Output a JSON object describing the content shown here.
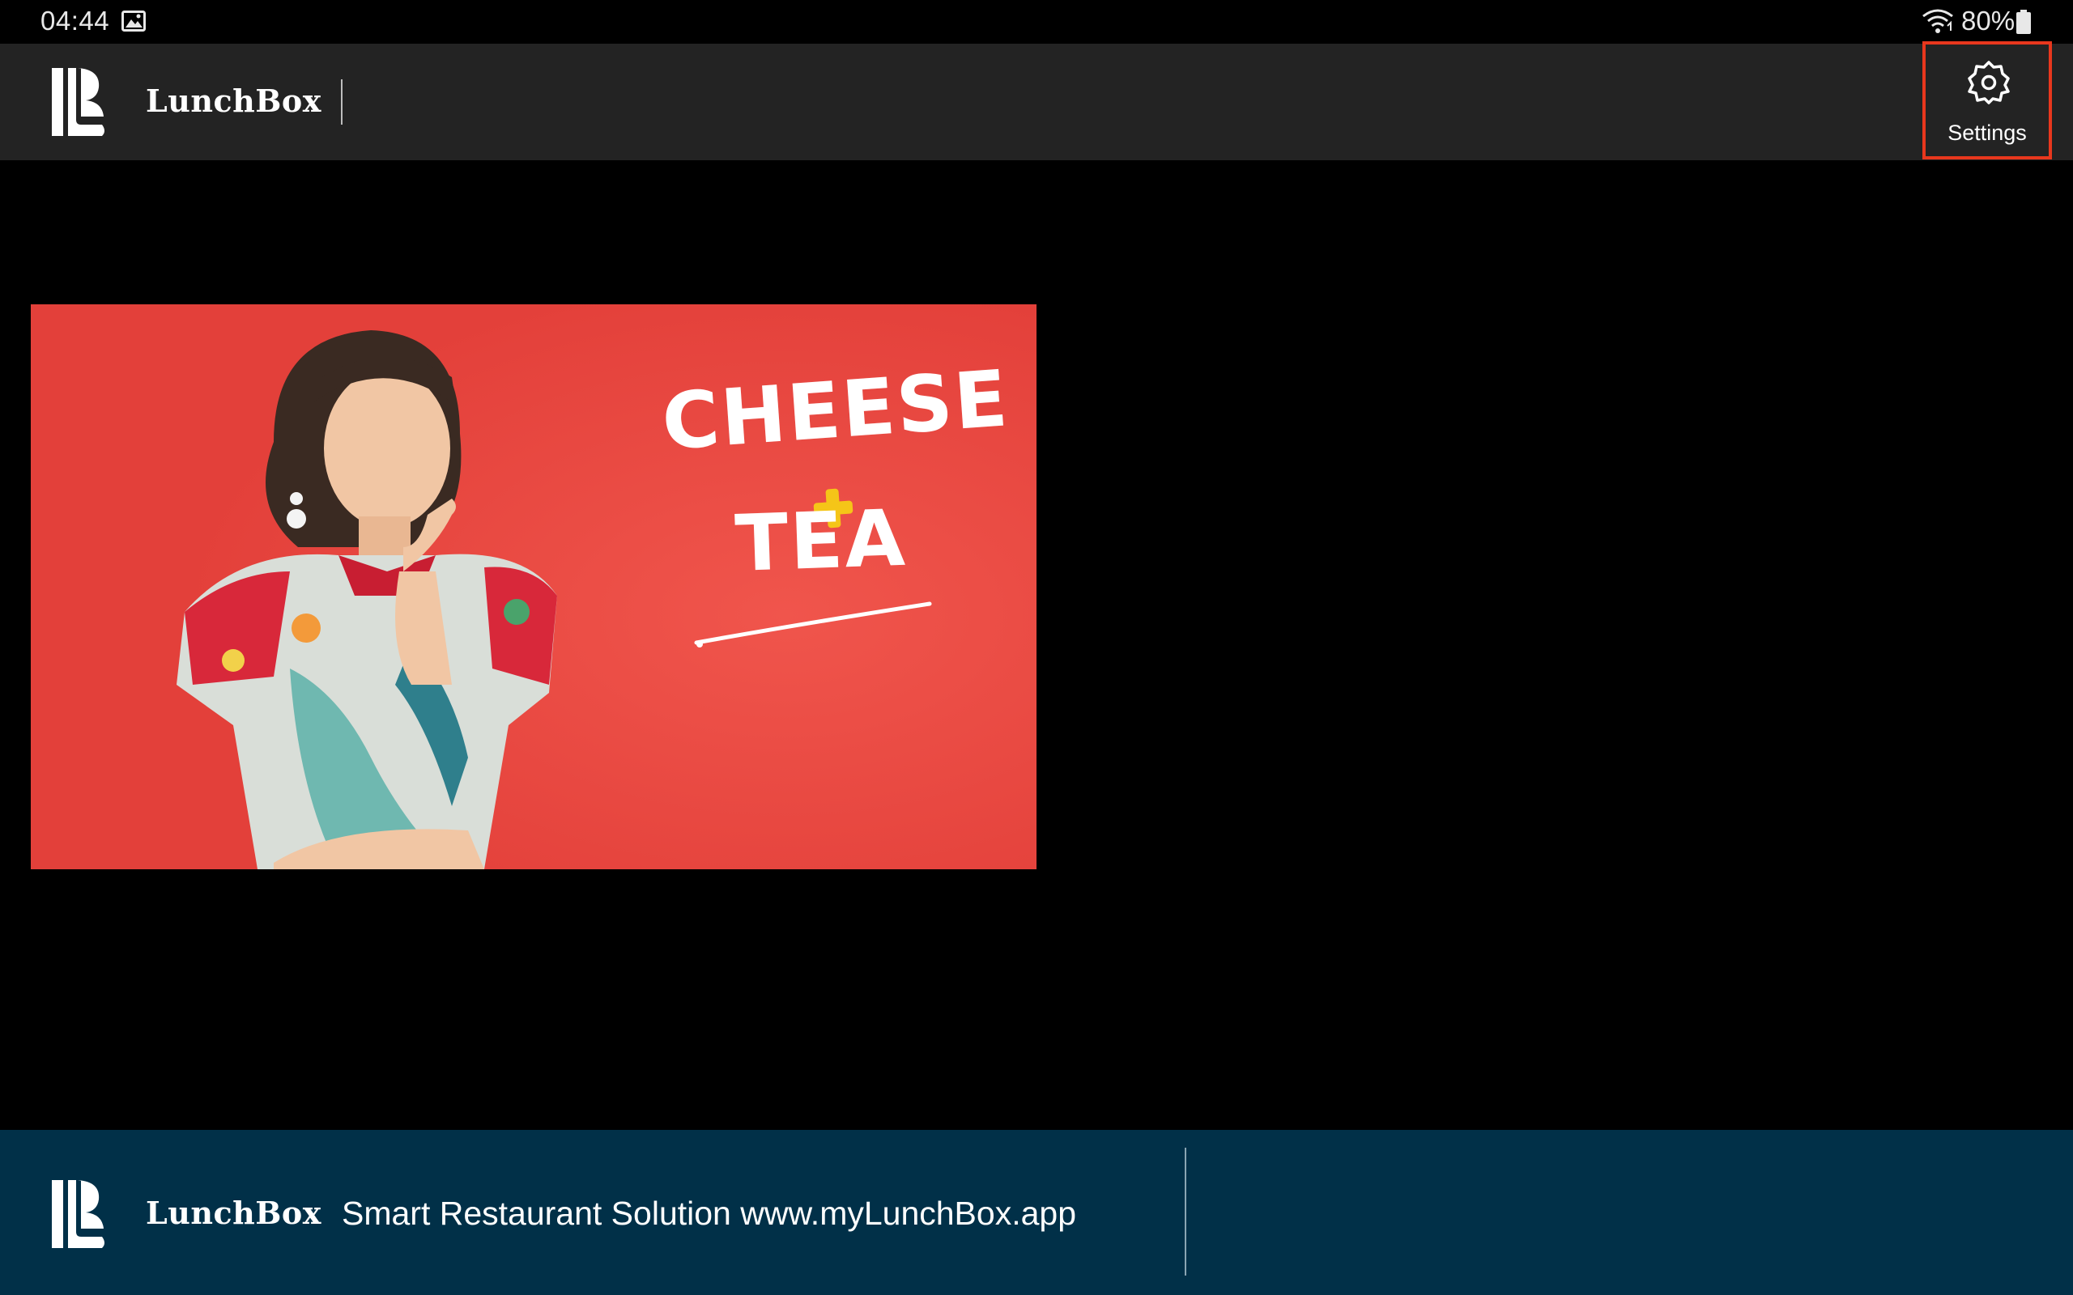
{
  "status_bar": {
    "time": "04:44",
    "battery": "80%",
    "icons": [
      "gallery-icon",
      "wifi-icon",
      "battery-icon"
    ]
  },
  "header": {
    "brand": "LunchBox",
    "settings_label": "Settings",
    "icons": [
      "lunchbox-logo-icon",
      "gear-icon"
    ]
  },
  "banner": {
    "headline_top": "CHEESE",
    "headline_plus": "+",
    "headline_bottom": "TEA"
  },
  "footer": {
    "brand": "LunchBox",
    "tagline": "Smart Restaurant Solution www.myLunchBox.app"
  },
  "colors": {
    "app_bar": "#232323",
    "footer": "#013048",
    "banner_red": "#e9453e",
    "plus_yellow": "#f5c518",
    "highlight_border": "#e8371d"
  }
}
